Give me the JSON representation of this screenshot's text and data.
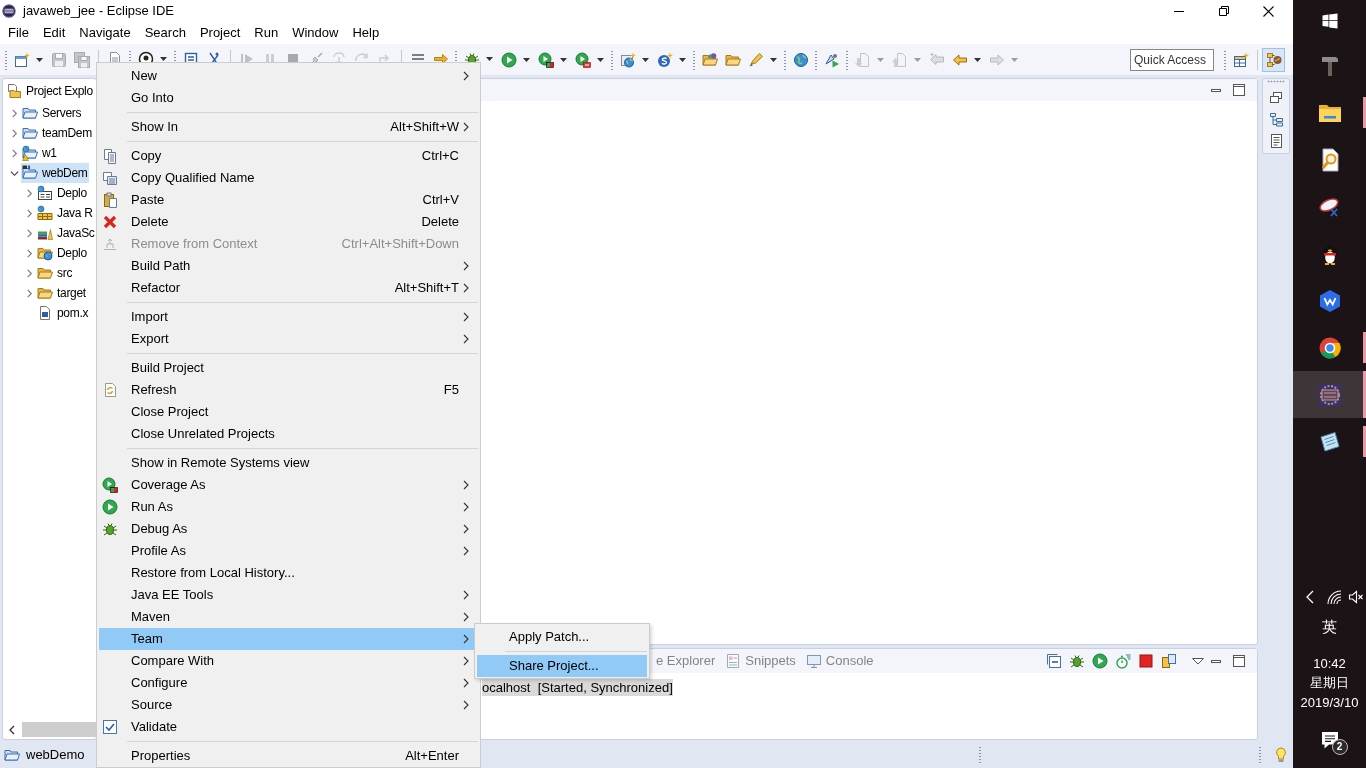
{
  "window": {
    "title": "javaweb_jee - Eclipse IDE"
  },
  "menu_bar": [
    "File",
    "Edit",
    "Navigate",
    "Search",
    "Project",
    "Run",
    "Window",
    "Help"
  ],
  "toolbar": {
    "items": [
      {
        "kind": "grip"
      },
      {
        "kind": "button",
        "disabled": false,
        "dropdown": true
      },
      {
        "kind": "button",
        "disabled": true,
        "dropdown": false
      },
      {
        "kind": "button",
        "disabled": true,
        "dropdown": false
      },
      {
        "kind": "separator"
      },
      {
        "kind": "button",
        "disabled": false,
        "dropdown": false
      },
      {
        "kind": "grip"
      },
      {
        "kind": "button",
        "disabled": false,
        "dropdown": true
      },
      {
        "kind": "grip"
      },
      {
        "kind": "button",
        "disabled": false,
        "dropdown": false
      },
      {
        "kind": "button",
        "disabled": false,
        "dropdown": false
      },
      {
        "kind": "separator"
      },
      {
        "kind": "button",
        "disabled": true,
        "dropdown": false
      },
      {
        "kind": "button",
        "disabled": true,
        "dropdown": false
      },
      {
        "kind": "button",
        "disabled": true,
        "dropdown": false
      },
      {
        "kind": "button",
        "disabled": true,
        "dropdown": false
      },
      {
        "kind": "button",
        "disabled": true,
        "dropdown": false
      },
      {
        "kind": "button",
        "disabled": true,
        "dropdown": false
      },
      {
        "kind": "button",
        "disabled": true,
        "dropdown": false
      },
      {
        "kind": "separator"
      },
      {
        "kind": "button",
        "disabled": false,
        "dropdown": false
      },
      {
        "kind": "button",
        "disabled": false,
        "dropdown": false
      },
      {
        "kind": "grip"
      },
      {
        "kind": "button",
        "disabled": false,
        "dropdown": true
      },
      {
        "kind": "button",
        "disabled": false,
        "dropdown": true
      },
      {
        "kind": "button",
        "disabled": false,
        "dropdown": true
      },
      {
        "kind": "button",
        "disabled": false,
        "dropdown": true
      },
      {
        "kind": "grip"
      },
      {
        "kind": "button",
        "disabled": false,
        "dropdown": true
      },
      {
        "kind": "button",
        "disabled": false,
        "dropdown": true
      },
      {
        "kind": "grip"
      },
      {
        "kind": "button",
        "disabled": false,
        "dropdown": false
      },
      {
        "kind": "button",
        "disabled": false,
        "dropdown": false
      },
      {
        "kind": "button",
        "disabled": false,
        "dropdown": true
      },
      {
        "kind": "grip"
      },
      {
        "kind": "button",
        "disabled": false,
        "dropdown": false
      },
      {
        "kind": "grip"
      },
      {
        "kind": "button",
        "disabled": false,
        "dropdown": false
      },
      {
        "kind": "grip"
      },
      {
        "kind": "button",
        "disabled": true,
        "dropdown": true
      },
      {
        "kind": "button",
        "disabled": true,
        "dropdown": true
      },
      {
        "kind": "button",
        "disabled": true,
        "dropdown": false
      },
      {
        "kind": "button",
        "disabled": false,
        "dropdown": true
      },
      {
        "kind": "button",
        "disabled": true,
        "dropdown": true
      }
    ],
    "quick_access": {
      "placeholder": "Quick Access"
    },
    "perspectives": [
      {
        "selected": false
      },
      {
        "selected": true
      }
    ]
  },
  "project_explorer": {
    "tab": "Project Explo",
    "tree": [
      {
        "label": "Servers",
        "expanded": false,
        "selected": false
      },
      {
        "label": "teamDem",
        "expanded": false,
        "selected": false
      },
      {
        "label": "w1",
        "expanded": false,
        "selected": false
      },
      {
        "label": "webDem",
        "expanded": true,
        "selected": true,
        "children": [
          {
            "label": "Deplo",
            "expanded": false,
            "selected": false
          },
          {
            "label": "Java R",
            "expanded": false,
            "selected": false
          },
          {
            "label": "JavaSc",
            "expanded": false,
            "selected": false
          },
          {
            "label": "Deplo",
            "expanded": false,
            "selected": false
          },
          {
            "label": "src",
            "expanded": false,
            "selected": false
          },
          {
            "label": "target",
            "expanded": false,
            "selected": false
          },
          {
            "label": "pom.x",
            "selected": false
          }
        ]
      }
    ]
  },
  "context_menu": {
    "items": [
      {
        "kind": "item",
        "label": "New",
        "has_submenu": true,
        "disabled": false,
        "selected": false
      },
      {
        "kind": "item",
        "label": "Go Into",
        "has_submenu": false,
        "disabled": false,
        "selected": false
      },
      {
        "kind": "separator"
      },
      {
        "kind": "item",
        "label": "Show In",
        "shortcut": "Alt+Shift+W",
        "has_submenu": true,
        "disabled": false,
        "selected": false
      },
      {
        "kind": "separator"
      },
      {
        "kind": "item",
        "label": "Copy",
        "shortcut": "Ctrl+C",
        "has_submenu": false,
        "disabled": false,
        "selected": false
      },
      {
        "kind": "item",
        "label": "Copy Qualified Name",
        "has_submenu": false,
        "disabled": false,
        "selected": false
      },
      {
        "kind": "item",
        "label": "Paste",
        "shortcut": "Ctrl+V",
        "has_submenu": false,
        "disabled": false,
        "selected": false
      },
      {
        "kind": "item",
        "label": "Delete",
        "shortcut": "Delete",
        "has_submenu": false,
        "disabled": false,
        "selected": false
      },
      {
        "kind": "item",
        "label": "Remove from Context",
        "shortcut": "Ctrl+Alt+Shift+Down",
        "has_submenu": false,
        "disabled": true,
        "selected": false
      },
      {
        "kind": "item",
        "label": "Build Path",
        "has_submenu": true,
        "disabled": false,
        "selected": false
      },
      {
        "kind": "item",
        "label": "Refactor",
        "shortcut": "Alt+Shift+T",
        "has_submenu": true,
        "disabled": false,
        "selected": false
      },
      {
        "kind": "separator"
      },
      {
        "kind": "item",
        "label": "Import",
        "has_submenu": true,
        "disabled": false,
        "selected": false
      },
      {
        "kind": "item",
        "label": "Export",
        "has_submenu": true,
        "disabled": false,
        "selected": false
      },
      {
        "kind": "separator"
      },
      {
        "kind": "item",
        "label": "Build Project",
        "has_submenu": false,
        "disabled": false,
        "selected": false
      },
      {
        "kind": "item",
        "label": "Refresh",
        "shortcut": "F5",
        "has_submenu": false,
        "disabled": false,
        "selected": false
      },
      {
        "kind": "item",
        "label": "Close Project",
        "has_submenu": false,
        "disabled": false,
        "selected": false
      },
      {
        "kind": "item",
        "label": "Close Unrelated Projects",
        "has_submenu": false,
        "disabled": false,
        "selected": false
      },
      {
        "kind": "separator"
      },
      {
        "kind": "item",
        "label": "Show in Remote Systems view",
        "has_submenu": false,
        "disabled": false,
        "selected": false
      },
      {
        "kind": "item",
        "label": "Coverage As",
        "has_submenu": true,
        "disabled": false,
        "selected": false
      },
      {
        "kind": "item",
        "label": "Run As",
        "has_submenu": true,
        "disabled": false,
        "selected": false
      },
      {
        "kind": "item",
        "label": "Debug As",
        "has_submenu": true,
        "disabled": false,
        "selected": false
      },
      {
        "kind": "item",
        "label": "Profile As",
        "has_submenu": true,
        "disabled": false,
        "selected": false
      },
      {
        "kind": "item",
        "label": "Restore from Local History...",
        "has_submenu": false,
        "disabled": false,
        "selected": false
      },
      {
        "kind": "item",
        "label": "Java EE Tools",
        "has_submenu": true,
        "disabled": false,
        "selected": false
      },
      {
        "kind": "item",
        "label": "Maven",
        "has_submenu": true,
        "disabled": false,
        "selected": false
      },
      {
        "kind": "item",
        "label": "Team",
        "has_submenu": true,
        "disabled": false,
        "selected": true
      },
      {
        "kind": "item",
        "label": "Compare With",
        "has_submenu": true,
        "disabled": false,
        "selected": false
      },
      {
        "kind": "item",
        "label": "Configure",
        "has_submenu": true,
        "disabled": false,
        "selected": false
      },
      {
        "kind": "item",
        "label": "Source",
        "has_submenu": true,
        "disabled": false,
        "selected": false
      },
      {
        "kind": "check",
        "label": "Validate",
        "checked": true,
        "has_submenu": false,
        "disabled": false,
        "selected": false
      },
      {
        "kind": "separator"
      },
      {
        "kind": "item",
        "label": "Properties",
        "shortcut": "Alt+Enter",
        "has_submenu": false,
        "disabled": false,
        "selected": false
      }
    ]
  },
  "submenu": {
    "items": [
      {
        "kind": "item",
        "label": "Apply Patch...",
        "has_submenu": false,
        "disabled": false,
        "selected": false
      },
      {
        "kind": "separator"
      },
      {
        "kind": "item",
        "label": "Share Project...",
        "has_submenu": false,
        "disabled": false,
        "selected": true
      }
    ]
  },
  "bottom_panel": {
    "tabs": [
      {
        "label": "e Explorer",
        "selected": false
      },
      {
        "label": "Snippets",
        "selected": false
      },
      {
        "label": "Console",
        "selected": false
      }
    ],
    "rows": [
      {
        "label": "ocalhost  [Started, Synchronized]",
        "selected": true
      }
    ]
  },
  "status_bar": {
    "text": "webDemo"
  },
  "taskbar": {
    "apps": [
      {
        "open": false,
        "selected": false
      },
      {
        "open": true,
        "selected": false
      },
      {
        "open": false,
        "selected": false
      },
      {
        "open": false,
        "selected": false
      },
      {
        "open": false,
        "selected": false
      },
      {
        "open": false,
        "selected": false
      },
      {
        "open": true,
        "selected": false
      },
      {
        "open": true,
        "selected": true
      },
      {
        "open": true,
        "selected": false
      }
    ],
    "tray": {
      "language": "英",
      "time": "10:42",
      "weekday": "星期日",
      "date": "2019/3/10",
      "notification_count": "2"
    }
  }
}
